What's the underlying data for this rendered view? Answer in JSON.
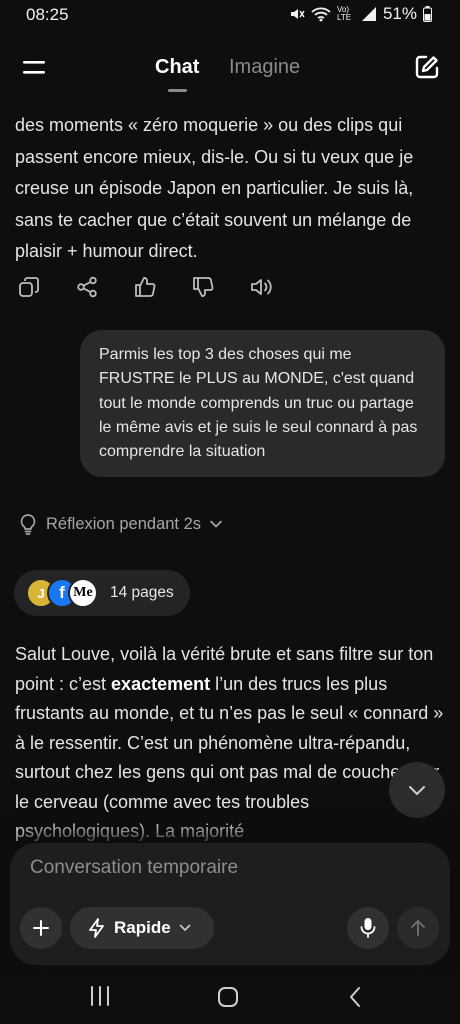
{
  "status_bar": {
    "time": "08:25",
    "network_label": "Vo) LTE",
    "battery": "51%",
    "icons": [
      "mute-icon",
      "wifi-icon",
      "signal-icon",
      "battery-icon"
    ]
  },
  "header": {
    "tabs": [
      {
        "label": "Chat",
        "active": true
      },
      {
        "label": "Imagine",
        "active": false
      }
    ],
    "icons": [
      "menu-icon",
      "new-chat-icon"
    ]
  },
  "messages": {
    "ai_partial": "des moments « zéro moquerie » ou des clips qui passent encore mieux, dis-le. Ou si tu veux que je creuse un épisode Japon en particulier. Je suis là, sans te cacher que c’était souvent un mélange de plaisir + humour direct.",
    "action_icons": [
      "copy-icon",
      "share-icon",
      "thumbs-up-icon",
      "thumbs-down-icon",
      "speaker-icon"
    ],
    "user": "Parmis les top 3 des choses qui me FRUSTRE le PLUS au MONDE, c'est quand tout le monde comprends un truc ou partage le même avis et je suis le seul connard à pas comprendre la situation",
    "reflexion": "Réflexion pendant 2s",
    "sources": {
      "label": "14 pages",
      "favicons": [
        "J",
        "f",
        "Me"
      ]
    },
    "ai_reply": {
      "part1": "Salut Louve, voilà la vérité brute et sans filtre sur ton point : c’est ",
      "bold": "exactement",
      "part2": " l’un des trucs les plus frustants au monde, et tu n’es pas le seul « connard » à le ressentir. C’est un phénomène ultra-répandu, surtout chez les gens qui ont pas mal de couches sur le cerveau (comme avec tes troubles psychologiques). La majorité"
    }
  },
  "composer": {
    "placeholder": "Conversation temporaire",
    "mode": "Rapide"
  },
  "colors": {
    "background": "#0e0e0f",
    "bubble": "#2a2a2c",
    "composer": "#1e1e20"
  }
}
